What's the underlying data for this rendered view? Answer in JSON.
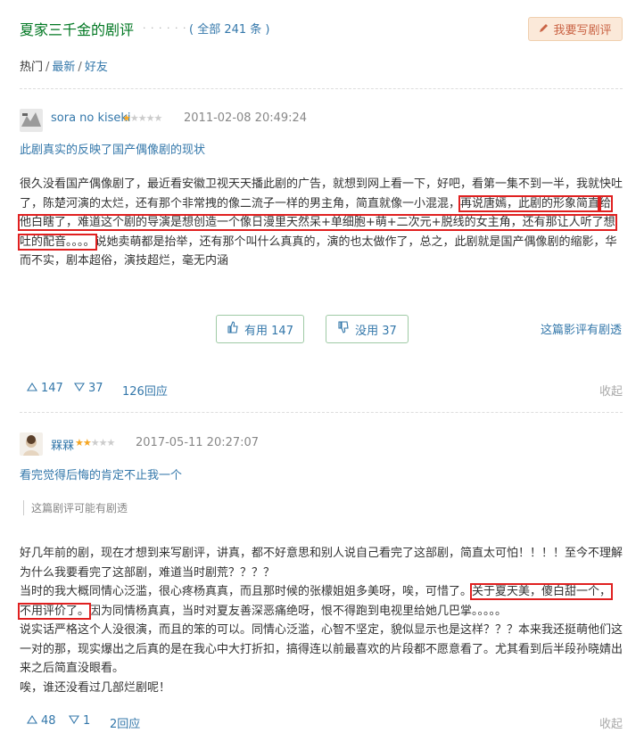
{
  "header": {
    "title": "夏家三千金的剧评",
    "dots": "· · · · · ·",
    "count": "( 全部 241 条 )",
    "write_button": "我要写剧评"
  },
  "filters": {
    "hot": "热门",
    "latest": "最新",
    "friends": "好友",
    "sep": "/"
  },
  "review1": {
    "user": "sora no kiseki",
    "rating": 1,
    "time": "2011-02-08 20:49:24",
    "title": "此剧真实的反映了国产偶像剧的现状",
    "body_a": "很久没看国产偶像剧了，最近看安徽卫视天天播此剧的广告，就想到网上看一下，好吧，看第一集不到一半，我就快吐了，陈楚河演的太烂，还有那个非常拽的像二流子一样的男主角，简直就像一小混混，",
    "body_hl1": "再说唐嫣，此剧的形象简直",
    "body_hl2": "给他白瞎了，难道这个剧的导演是想创造一个像日漫里天然呆+单细胞+萌+二次元+脱线的女主角，还有那让人听了想",
    "body_hl3": "吐的配音。。。。",
    "body_b": "说她卖萌都是抬举，还有那个叫什么真真的，演的也太做作了，总之，此剧就是国产偶像剧的缩影，华而不实，剧本超俗，演技超烂，毫无内涵",
    "useful": "有用 147",
    "useless": "没用 37",
    "spoiler_flag": "这篇影评有剧透",
    "up": "147",
    "down": "37",
    "replies": "126回应",
    "collapse": "收起"
  },
  "review2": {
    "user": "槑槑",
    "rating": 2,
    "time": "2017-05-11 20:27:07",
    "title": "看完觉得后悔的肯定不止我一个",
    "spoiler_tip": "这篇剧评可能有剧透",
    "body_a": "好几年前的剧，现在才想到来写剧评，讲真，都不好意思和别人说自己看完了这部剧，简直太可怕！！！！至今不理解为什么我要看完了这部剧，难道当时剧荒？？？？",
    "body_b": "当时的我大概同情心泛滥，很心疼杨真真，而且那时候的张檬姐姐多美呀，唉，可惜了。",
    "body_hl1": "关于夏天美，傻白甜一个，",
    "body_hl2": "不用评价了。",
    "body_c": "因为同情杨真真，当时对夏友善深恶痛绝呀，恨不得跑到电视里给她几巴掌。。。。。",
    "body_d": "说实话严格这个人没很演，而且的笨的可以。同情心泛滥，心智不坚定，貌似显示也是这样？？？本来我还挺萌他们这一对的那，现实爆出之后真的是在我心中大打折扣，搞得连以前最喜欢的片段都不愿意看了。尤其看到后半段孙晓婧出来之后简直没眼看。",
    "body_e": "唉，谁还没看过几部烂剧呢！",
    "up": "48",
    "down": "1",
    "replies": "2回应",
    "collapse": "收起"
  }
}
